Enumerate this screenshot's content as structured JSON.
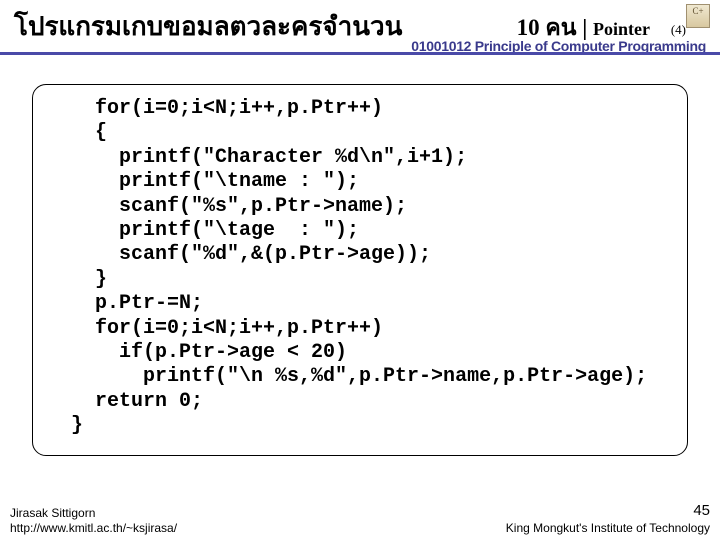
{
  "header": {
    "title_left": "โปรแกรมเกบขอมลตวละครจำนวน",
    "title_right_a": "10 คน",
    "title_right_sep": " | ",
    "title_right_b": "Pointer",
    "page_badge": "(4)",
    "logo_text": "C+",
    "course_line": "01001012 Principle of Computer Programming"
  },
  "code_lines": [
    "  for(i=0;i<N;i++,p.Ptr++)",
    "  {",
    "    printf(\"Character %d\\n\",i+1);",
    "    printf(\"\\tname : \");",
    "    scanf(\"%s\",p.Ptr->name);",
    "    printf(\"\\tage  : \");",
    "    scanf(\"%d\",&(p.Ptr->age));",
    "  }",
    "  p.Ptr-=N;",
    "  for(i=0;i<N;i++,p.Ptr++)",
    "    if(p.Ptr->age < 20)",
    "      printf(\"\\n %s,%d\",p.Ptr->name,p.Ptr->age);",
    "  return 0;",
    "}"
  ],
  "footer": {
    "author": "Jirasak Sittigorn",
    "url": "http://www.kmitl.ac.th/~ksjirasa/",
    "slide_num": "45",
    "institute": "King Mongkut's Institute of Technology"
  }
}
